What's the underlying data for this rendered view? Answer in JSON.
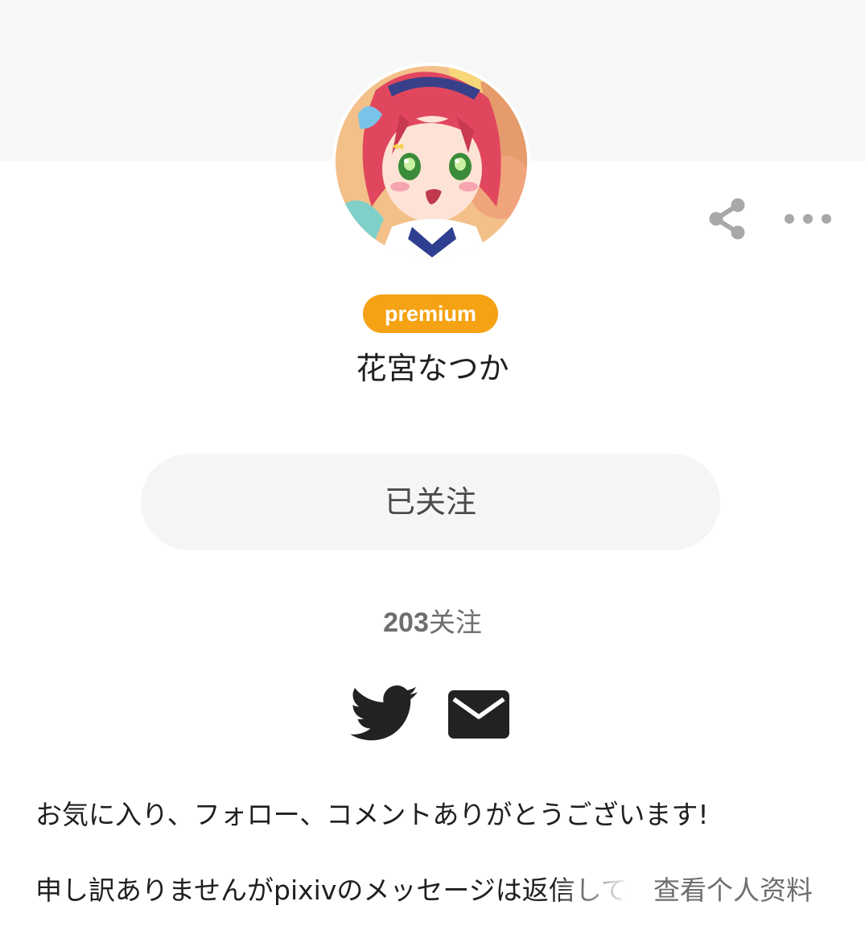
{
  "profile": {
    "badge": "premium",
    "username": "花宮なつか",
    "follow_button_label": "已关注",
    "follow_count": "203",
    "follow_count_suffix": "关注",
    "bio_line_1": "お気に入り、フォロー、コメントありがとうございます!",
    "bio_line_2": "申し訳ありませんがpixivのメッセージは返信しておりません",
    "view_profile_label": "查看个人资料"
  },
  "icons": {
    "share": "share-icon",
    "more": "more-icon",
    "twitter": "twitter-icon",
    "mail": "mail-icon"
  },
  "colors": {
    "badge_bg": "#f5a214",
    "button_bg": "#f5f5f5",
    "cover_bg": "#f7f7f7",
    "icon_gray": "#a8a8a8",
    "icon_dark": "#222222"
  }
}
